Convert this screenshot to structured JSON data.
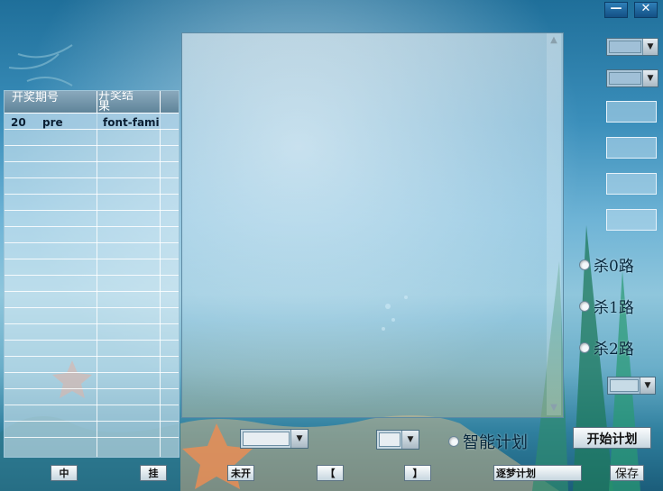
{
  "window": {
    "minimize_label": "—",
    "close_label": "✕"
  },
  "history_table": {
    "columns": [
      "开奖期号",
      "开奖结果"
    ],
    "rows": [
      [
        "20",
        "pre",
        "font-fami"
      ]
    ]
  },
  "kill_options": [
    {
      "label": "杀0路"
    },
    {
      "label": "杀1路"
    },
    {
      "label": "杀2路"
    }
  ],
  "smart_plan": {
    "label": "智能计划"
  },
  "buttons": {
    "start_plan": "开始计划",
    "hit": "中",
    "miss": "挂",
    "not_opened": "未开",
    "prev": "【",
    "next": "】",
    "dream_plan": "逐梦计划",
    "save": "保存"
  },
  "colors": {
    "accent": "#134f84",
    "table_header": "#6f93a8"
  }
}
